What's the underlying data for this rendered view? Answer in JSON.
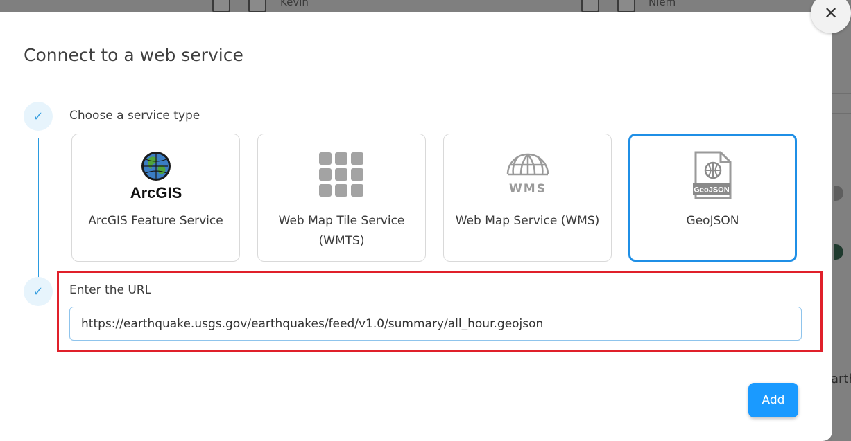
{
  "background": {
    "left_text": "Kevin",
    "right_text": "Niem",
    "side_text": "arth"
  },
  "dialog": {
    "title": "Connect to a web service",
    "close_glyph": "✕"
  },
  "steps": [
    {
      "check": "✓",
      "label": "Choose a service type"
    },
    {
      "check": "✓",
      "label": "Enter the URL"
    }
  ],
  "services": [
    {
      "icon": "arcgis-globe-icon",
      "logo_text": "ArcGIS",
      "label": "ArcGIS Feature Service",
      "selected": false
    },
    {
      "icon": "tile-grid-icon",
      "label": "Web Map Tile Service (WMTS)",
      "selected": false
    },
    {
      "icon": "wms-globe-icon",
      "logo_text": "WMS",
      "label": "Web Map Service (WMS)",
      "selected": false
    },
    {
      "icon": "geojson-file-icon",
      "logo_text": "GeoJSON",
      "label": "GeoJSON",
      "selected": true
    }
  ],
  "url": {
    "value": "https://earthquake.usgs.gov/earthquakes/feed/v1.0/summary/all_hour.geojson"
  },
  "actions": {
    "add_label": "Add"
  },
  "colors": {
    "accent": "#1a9aff",
    "selected_border": "#1f8fe6",
    "highlight": "#e0202a"
  }
}
